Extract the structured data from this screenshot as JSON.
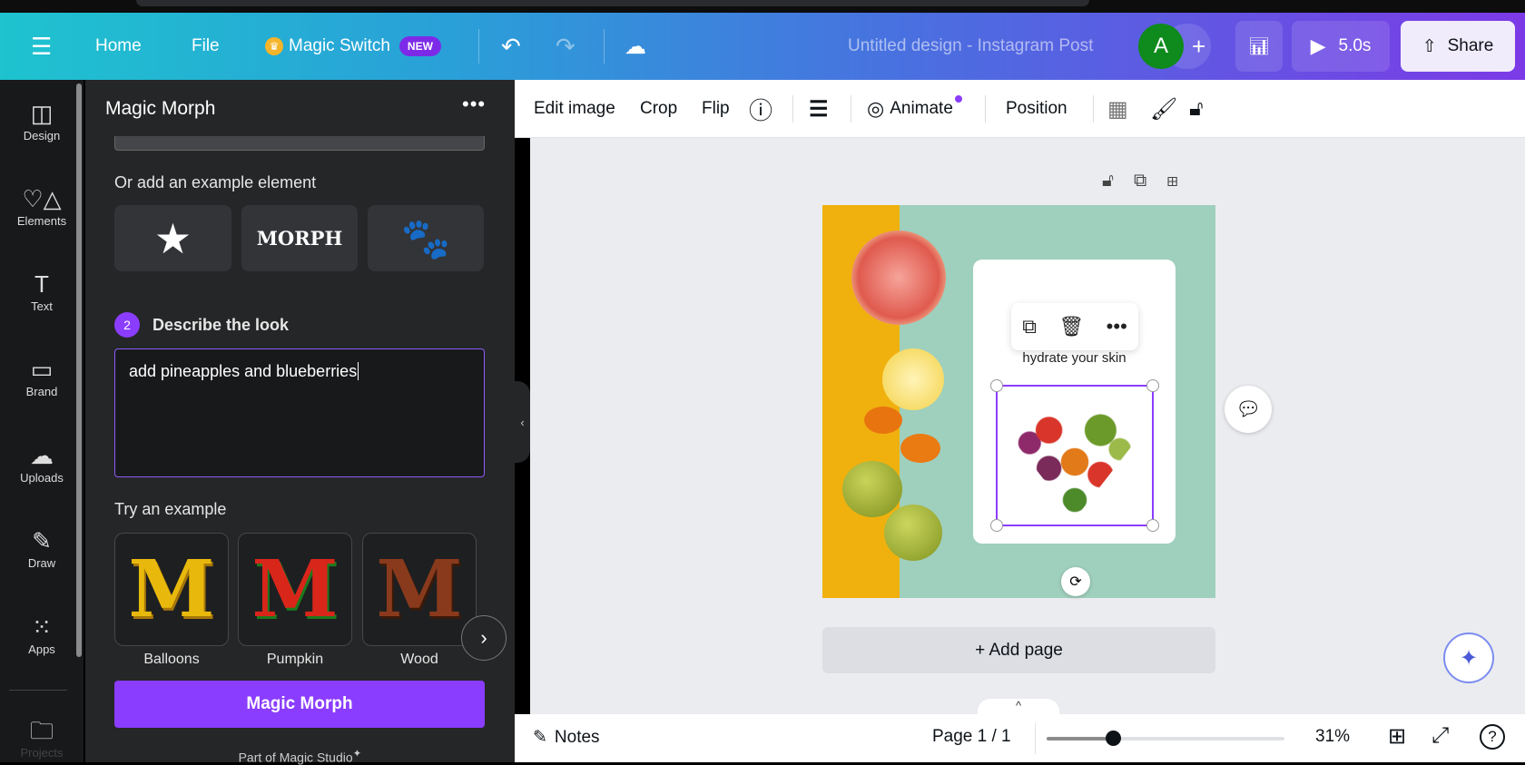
{
  "header": {
    "home": "Home",
    "file": "File",
    "magic_switch": "Magic Switch",
    "new_badge": "NEW",
    "title": "Untitled design - Instagram Post",
    "avatar_letter": "A",
    "play_duration": "5.0s",
    "share": "Share"
  },
  "rail": [
    {
      "label": "Design",
      "icon": "layout-icon"
    },
    {
      "label": "Elements",
      "icon": "shapes-icon"
    },
    {
      "label": "Text",
      "icon": "text-icon"
    },
    {
      "label": "Brand",
      "icon": "brand-icon"
    },
    {
      "label": "Uploads",
      "icon": "cloud-upload-icon"
    },
    {
      "label": "Draw",
      "icon": "draw-icon"
    },
    {
      "label": "Apps",
      "icon": "apps-icon"
    },
    {
      "label": "Projects",
      "icon": "folder-icon"
    }
  ],
  "panel": {
    "title": "Magic Morph",
    "add_example_label": "Or add an example element",
    "example_elements": [
      "★",
      "MORPH",
      "🐾"
    ],
    "step_number": "2",
    "step_label": "Describe the look",
    "prompt_value": "add pineapples and blueberries",
    "try_example_label": "Try an example",
    "examples": [
      {
        "label": "Balloons",
        "letter": "M"
      },
      {
        "label": "Pumpkin",
        "letter": "M"
      },
      {
        "label": "Wood",
        "letter": "M"
      }
    ],
    "button": "Magic Morph",
    "footer": "Part of Magic Studio"
  },
  "toolbar": {
    "edit_image": "Edit image",
    "crop": "Crop",
    "flip": "Flip",
    "animate": "Animate",
    "position": "Position"
  },
  "canvas": {
    "card_text": "hydrate your skin",
    "add_page": "+ Add page"
  },
  "bottom": {
    "notes": "Notes",
    "page": "Page 1 / 1",
    "zoom": "31%",
    "zoom_fraction": 0.31
  },
  "colors": {
    "accent": "#8b3dff",
    "avatar": "#0f8a1c"
  }
}
